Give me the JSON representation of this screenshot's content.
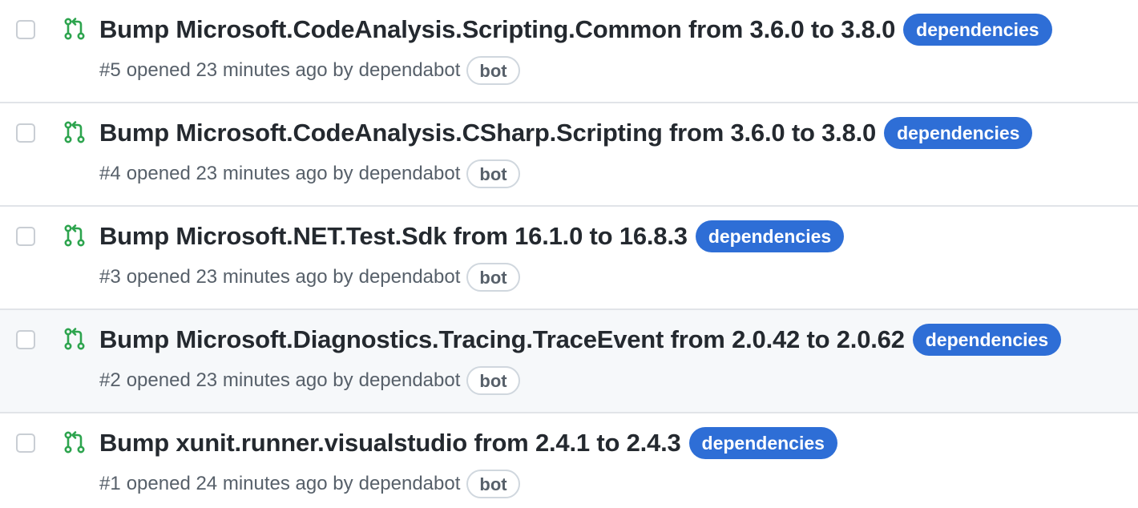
{
  "pull_requests": [
    {
      "title": "Bump Microsoft.CodeAnalysis.Scripting.Common from 3.6.0 to 3.8.0",
      "label": "dependencies",
      "number": "#5",
      "opened": "opened 23 minutes ago by",
      "author": "dependabot",
      "badge": "bot"
    },
    {
      "title": "Bump Microsoft.CodeAnalysis.CSharp.Scripting from 3.6.0 to 3.8.0",
      "label": "dependencies",
      "number": "#4",
      "opened": "opened 23 minutes ago by",
      "author": "dependabot",
      "badge": "bot"
    },
    {
      "title": "Bump Microsoft.NET.Test.Sdk from 16.1.0 to 16.8.3",
      "label": "dependencies",
      "number": "#3",
      "opened": "opened 23 minutes ago by",
      "author": "dependabot",
      "badge": "bot"
    },
    {
      "title": "Bump Microsoft.Diagnostics.Tracing.TraceEvent from 2.0.42 to 2.0.62",
      "label": "dependencies",
      "number": "#2",
      "opened": "opened 23 minutes ago by",
      "author": "dependabot",
      "badge": "bot"
    },
    {
      "title": "Bump xunit.runner.visualstudio from 2.4.1 to 2.4.3",
      "label": "dependencies",
      "number": "#1",
      "opened": "opened 24 minutes ago by",
      "author": "dependabot",
      "badge": "bot"
    }
  ],
  "colors": {
    "pr_open_icon": "#2da44e",
    "label_bg": "#2e6ed6",
    "hover_row_bg": "#f6f8fa"
  },
  "icons": {
    "status": "git-pull-request-open-icon"
  }
}
